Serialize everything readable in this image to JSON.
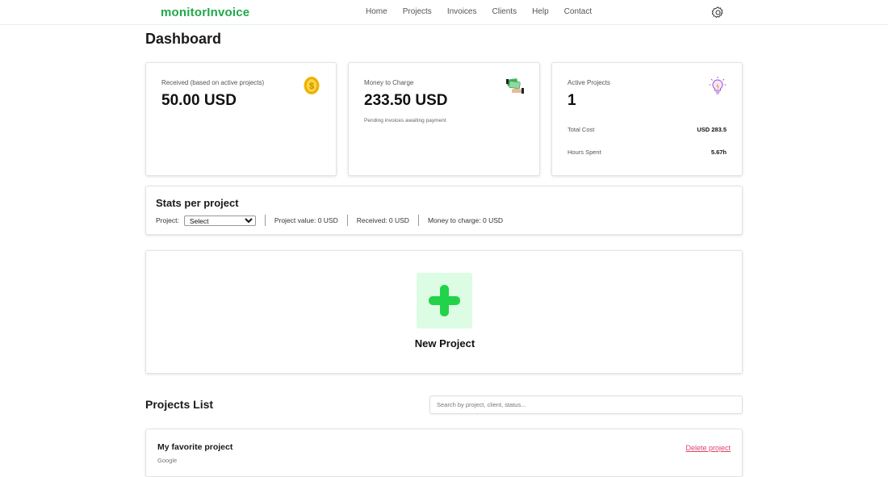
{
  "brand": "monitorInvoice",
  "nav": [
    "Home",
    "Projects",
    "Invoices",
    "Clients",
    "Help",
    "Contact"
  ],
  "page_title": "Dashboard",
  "cards": {
    "received": {
      "label": "Received (based on active projects)",
      "value": "50.00 USD",
      "icon": "gold-coin-icon"
    },
    "to_charge": {
      "label": "Money to Charge",
      "value": "233.50 USD",
      "sub": "Pending invoices awaiting payment",
      "icon": "cash-hand-icon"
    },
    "active": {
      "label": "Active Projects",
      "value": "1",
      "icon": "lightbulb-icon",
      "total_cost_label": "Total Cost",
      "total_cost_value": "USD 283.5",
      "hours_label": "Hours Spent",
      "hours_value": "5.67h"
    }
  },
  "stats": {
    "title": "Stats per project",
    "project_label": "Project:",
    "select_value": "Select",
    "project_value": "Project value: 0 USD",
    "received": "Received: 0 USD",
    "money_to_charge": "Money to charge: 0 USD"
  },
  "new_project": {
    "label": "New Project",
    "icon": "plus-icon"
  },
  "projects_list": {
    "title": "Projects List",
    "search_placeholder": "Search by project, client, status...",
    "items": [
      {
        "name": "My favorite project",
        "client": "Google",
        "delete_label": "Delete project"
      }
    ]
  },
  "colors": {
    "brand": "#1fa84a",
    "plus": "#22d34a",
    "plus_bg": "#dcfce4",
    "delete": "#e0436b"
  }
}
